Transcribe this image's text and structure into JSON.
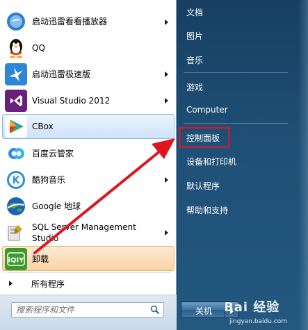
{
  "programs": [
    {
      "label": "启动迅雷看看播放器",
      "icon": "xunlei-kankan-icon",
      "has_submenu": true
    },
    {
      "label": "QQ",
      "icon": "qq-penguin-icon",
      "has_submenu": false
    },
    {
      "label": "启动迅雷极速版",
      "icon": "xunlei-bird-icon",
      "has_submenu": true
    },
    {
      "label": "Visual Studio 2012",
      "icon": "visual-studio-icon",
      "has_submenu": true
    },
    {
      "label": "CBox",
      "icon": "cbox-icon",
      "has_submenu": false,
      "highlighted": true
    },
    {
      "label": "百度云管家",
      "icon": "baidu-cloud-icon",
      "has_submenu": false
    },
    {
      "label": "酷狗音乐",
      "icon": "kugou-icon",
      "has_submenu": true
    },
    {
      "label": "Google 地球",
      "icon": "google-earth-icon",
      "has_submenu": false
    },
    {
      "label": "SQL Server Management Studio",
      "label_line1": "SQL Server Management",
      "label_line2": "Studio",
      "icon": "sql-server-icon",
      "has_submenu": true
    },
    {
      "label": "卸载",
      "icon": "iqiyi-icon",
      "has_submenu": false,
      "highlighted": true
    }
  ],
  "all_programs": {
    "label": "所有程序"
  },
  "search": {
    "placeholder": "搜索程序和文件"
  },
  "right_items": [
    {
      "label": "文档"
    },
    {
      "label": "图片"
    },
    {
      "label": "音乐"
    },
    {
      "label": "游戏"
    },
    {
      "label": "Computer"
    },
    {
      "label": "控制面板",
      "highlighted": true
    },
    {
      "label": "设备和打印机"
    },
    {
      "label": "默认程序"
    },
    {
      "label": "帮助和支持"
    }
  ],
  "shutdown": {
    "label": "关机"
  },
  "watermark": {
    "brand": "Bai 经验",
    "url": "jingyan.baidu.com"
  },
  "colors": {
    "annotation_red": "#e0141d",
    "selection_blue": "#cfe3fb",
    "selection_orange": "#fbd3a6",
    "right_panel": "#1f5077"
  }
}
